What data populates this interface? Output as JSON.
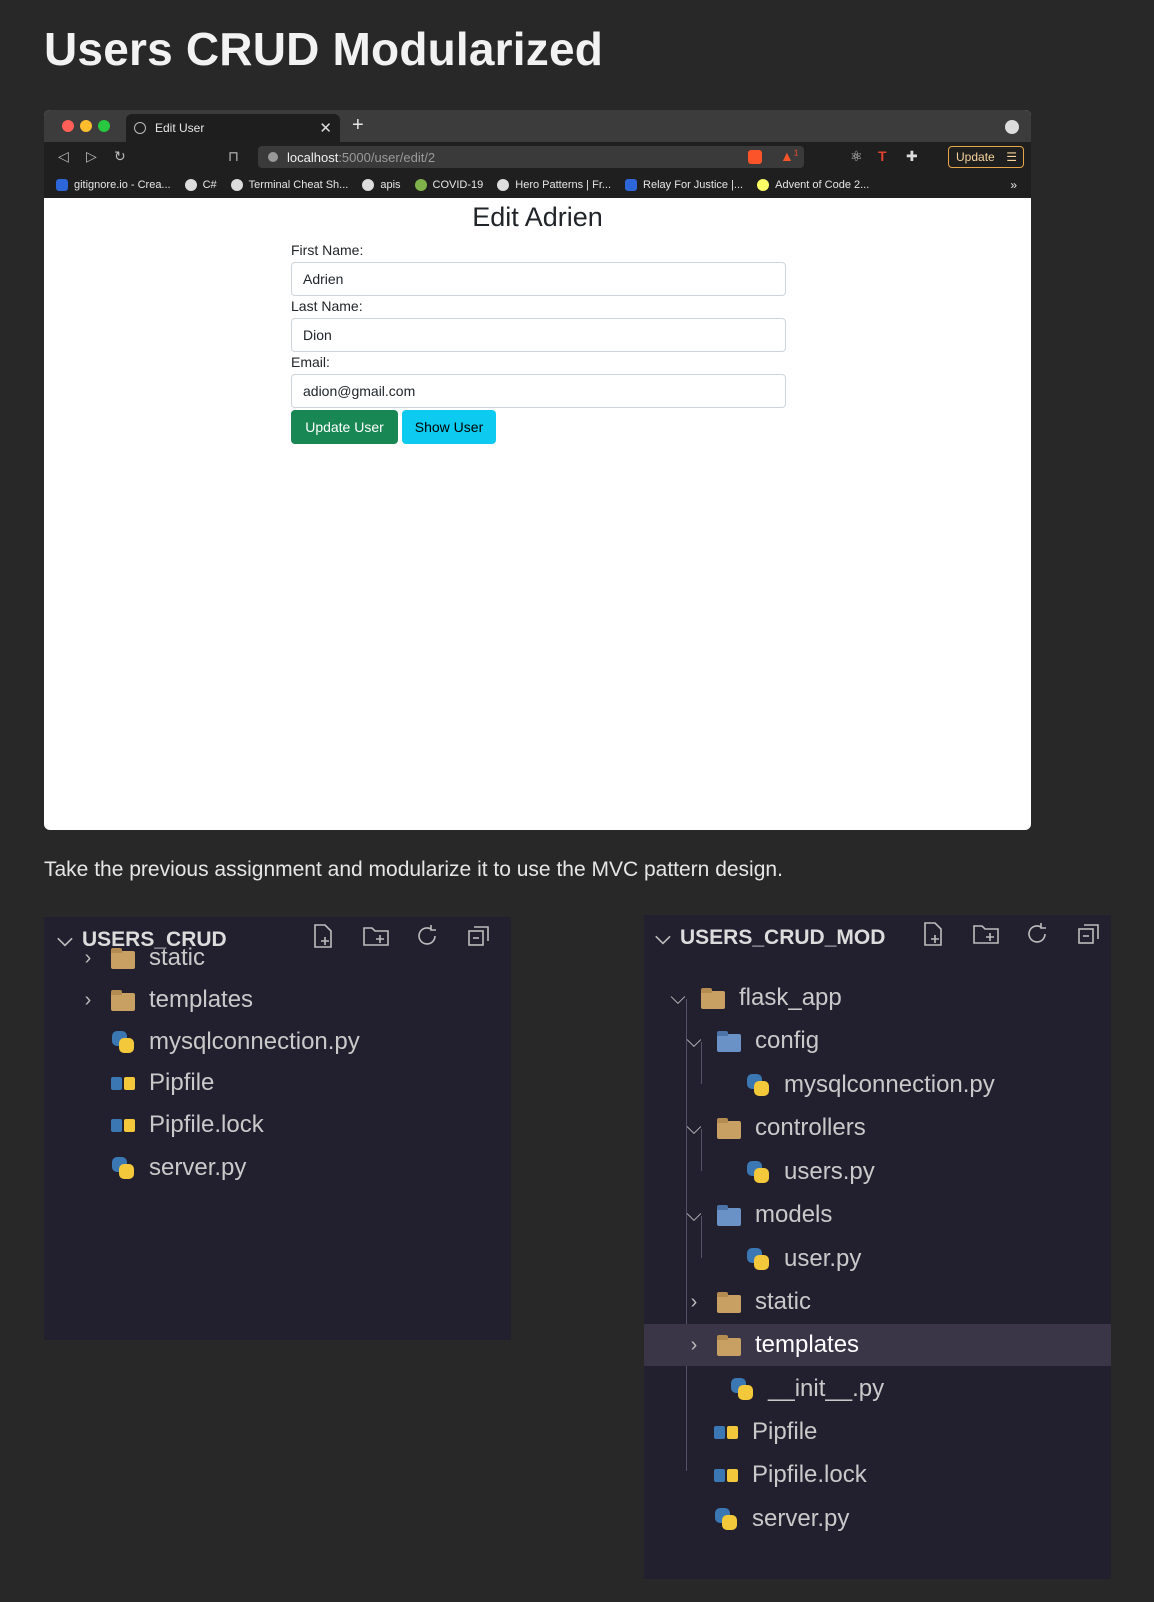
{
  "page_title": "Users CRUD Modularized",
  "browser": {
    "tab_title": "Edit User",
    "url_host": "localhost",
    "url_path": ":5000/user/edit/2",
    "alert_count": "1",
    "update_label": "Update",
    "bookmarks": [
      {
        "label": "gitignore.io - Crea...",
        "icon_color": "#2d66d8"
      },
      {
        "label": "C#",
        "icon_color": "#dddddd"
      },
      {
        "label": "Terminal Cheat Sh...",
        "icon_color": "#dddddd"
      },
      {
        "label": "apis",
        "icon_color": "#dddddd"
      },
      {
        "label": "COVID-19",
        "icon_color": "#7fb24a"
      },
      {
        "label": "Hero Patterns | Fr...",
        "icon_color": "#dddddd"
      },
      {
        "label": "Relay For Justice |...",
        "icon_color": "#2d66d8"
      },
      {
        "label": "Advent of Code 2...",
        "icon_color": "#ffff66"
      }
    ],
    "bookmarks_more": "»",
    "form": {
      "title": "Edit Adrien",
      "first_name_label": "First Name:",
      "first_name_value": "Adrien",
      "last_name_label": "Last Name:",
      "last_name_value": "Dion",
      "email_label": "Email:",
      "email_value": "adion@gmail.com",
      "update_button": "Update User",
      "show_button": "Show User",
      "update_color": "#198754",
      "show_color": "#0dcaf0"
    }
  },
  "description": "Take the previous assignment and modularize it to use the MVC pattern design.",
  "explorer_left": {
    "title": "USERS_CRUD",
    "items": [
      {
        "label": "static",
        "icon": "folder-icon",
        "expandable": true
      },
      {
        "label": "templates",
        "icon": "templates-folder-icon",
        "expandable": true
      },
      {
        "label": "mysqlconnection.py",
        "icon": "python-icon",
        "expandable": false
      },
      {
        "label": "Pipfile",
        "icon": "pipfile-icon",
        "expandable": false
      },
      {
        "label": "Pipfile.lock",
        "icon": "pipfile-icon",
        "expandable": false
      },
      {
        "label": "server.py",
        "icon": "python-icon",
        "expandable": false
      }
    ]
  },
  "explorer_right": {
    "title": "USERS_CRUD_MOD",
    "items": [
      {
        "label": "flask_app",
        "icon": "folder-open-icon",
        "depth": 0
      },
      {
        "label": "config",
        "icon": "config-folder-icon",
        "depth": 1
      },
      {
        "label": "mysqlconnection.py",
        "icon": "python-icon",
        "depth": 2
      },
      {
        "label": "controllers",
        "icon": "controllers-folder-icon",
        "depth": 1
      },
      {
        "label": "users.py",
        "icon": "python-icon",
        "depth": 2
      },
      {
        "label": "models",
        "icon": "models-folder-icon",
        "depth": 1
      },
      {
        "label": "user.py",
        "icon": "python-icon",
        "depth": 2
      },
      {
        "label": "static",
        "icon": "folder-icon",
        "depth": 1
      },
      {
        "label": "templates",
        "icon": "templates-folder-icon",
        "depth": 1,
        "selected": true
      },
      {
        "label": "__init__.py",
        "icon": "python-icon",
        "depth": 1
      },
      {
        "label": "Pipfile",
        "icon": "pipfile-icon",
        "depth": 0
      },
      {
        "label": "Pipfile.lock",
        "icon": "pipfile-icon",
        "depth": 0
      },
      {
        "label": "server.py",
        "icon": "python-icon",
        "depth": 0
      }
    ]
  }
}
